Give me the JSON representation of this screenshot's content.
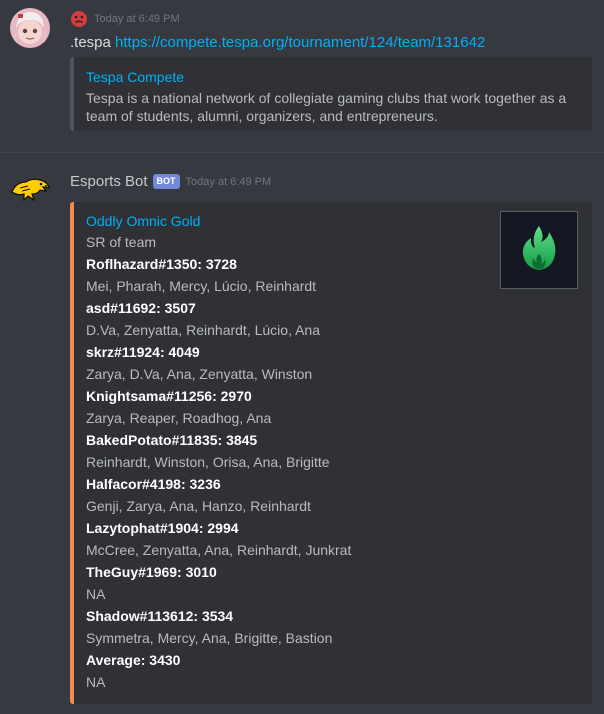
{
  "messages": [
    {
      "username": "",
      "timestamp": "Today at 6:49 PM",
      "text_prefix": ".tespa ",
      "link": "https://compete.tespa.org/tournament/124/team/131642",
      "embed": {
        "provider": "Tespa Compete",
        "description": "Tespa is a national network of collegiate gaming clubs that work together as a team of students, alumni, organizers, and entrepreneurs."
      }
    },
    {
      "username": "Esports Bot",
      "bot_tag": "BOT",
      "timestamp": "Today at 6:49 PM",
      "embed": {
        "title": "Oddly Omnic Gold",
        "subtitle": "SR of team",
        "accent_color": "#f38a4e",
        "fields": [
          {
            "name": "Roflhazard#1350: 3728",
            "value": "Mei, Pharah, Mercy, Lúcio, Reinhardt"
          },
          {
            "name": "asd#11692: 3507",
            "value": "D.Va, Zenyatta, Reinhardt, Lúcio, Ana"
          },
          {
            "name": "skrz#11924: 4049",
            "value": "Zarya, D.Va, Ana, Zenyatta, Winston"
          },
          {
            "name": "Knightsama#11256: 2970",
            "value": "Zarya, Reaper, Roadhog, Ana"
          },
          {
            "name": "BakedPotato#11835: 3845",
            "value": "Reinhardt, Winston, Orisa, Ana, Brigitte"
          },
          {
            "name": "Halfacor#4198: 3236",
            "value": "Genji, Zarya, Ana, Hanzo, Reinhardt"
          },
          {
            "name": "Lazytophat#1904: 2994",
            "value": "McCree, Zenyatta, Ana, Reinhardt, Junkrat"
          },
          {
            "name": "TheGuy#1969: 3010",
            "value": "NA"
          },
          {
            "name": "Shadow#113612: 3534",
            "value": "Symmetra, Mercy, Ana, Brigitte, Bastion"
          },
          {
            "name": "Average: 3430",
            "value": "NA"
          }
        ]
      }
    }
  ]
}
